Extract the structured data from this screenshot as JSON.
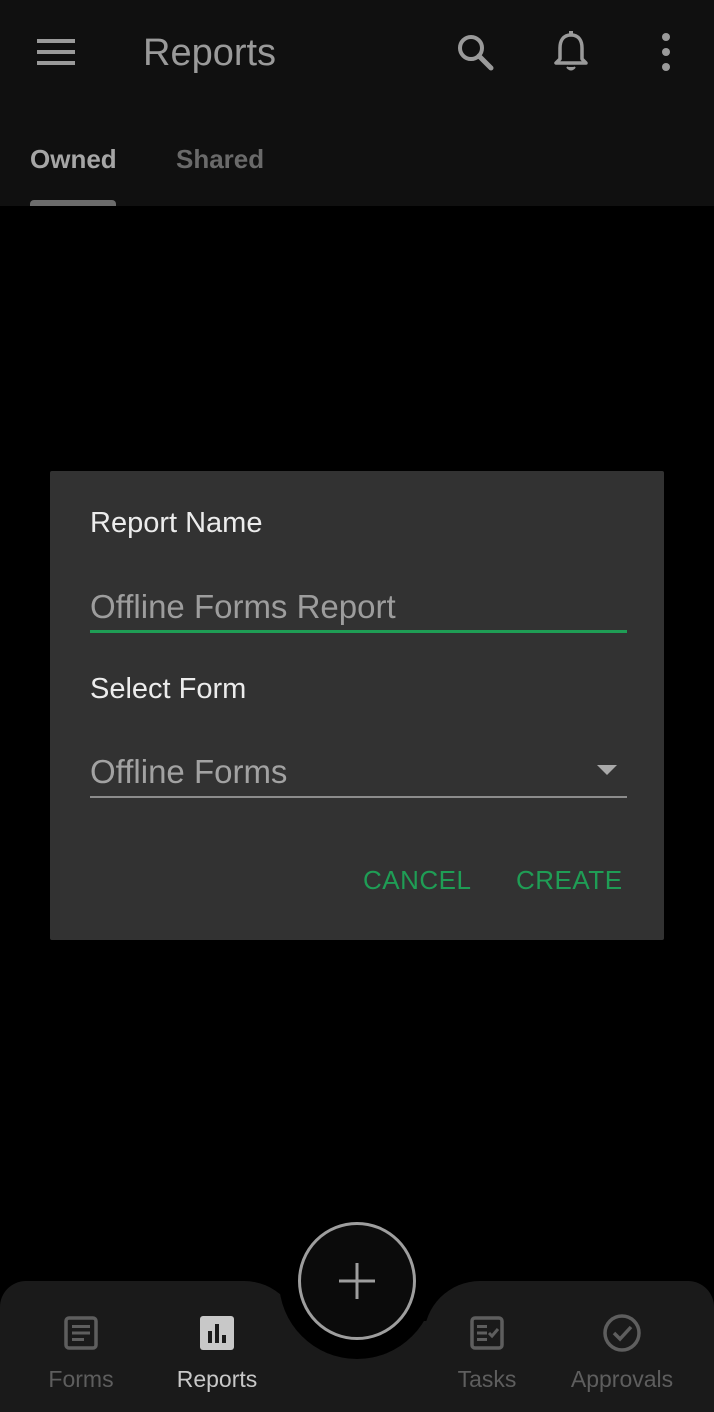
{
  "appbar": {
    "title": "Reports",
    "icons": [
      "menu-icon",
      "search-icon",
      "bell-icon",
      "more-vert-icon"
    ]
  },
  "tabs": [
    {
      "label": "Owned",
      "selected": true
    },
    {
      "label": "Shared",
      "selected": false
    }
  ],
  "dialog": {
    "report_name_label": "Report Name",
    "report_name_value": "Offline Forms Report",
    "select_form_label": "Select Form",
    "select_form_value": "Offline Forms",
    "cancel_label": "CANCEL",
    "create_label": "CREATE"
  },
  "bottom_nav": {
    "items": [
      {
        "label": "Forms",
        "icon": "document-icon",
        "active": false
      },
      {
        "label": "Reports",
        "icon": "bar-chart-icon",
        "active": true
      },
      {
        "label": "Tasks",
        "icon": "task-list-icon",
        "active": false
      },
      {
        "label": "Approvals",
        "icon": "check-circle-icon",
        "active": false
      }
    ],
    "fab_icon": "plus-icon"
  },
  "colors": {
    "accent": "#1f9d55",
    "appbar_bg": "#101010",
    "dialog_bg": "#323232",
    "nav_bg": "#1a1a1a"
  }
}
